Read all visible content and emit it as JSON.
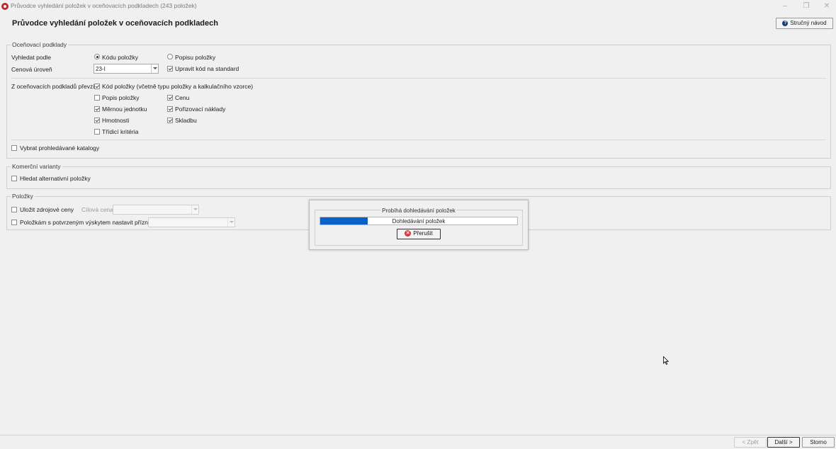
{
  "window": {
    "title": "Průvodce vyhledání položek v oceňovacích podkladech (243 položek)",
    "minimize_glyph": "–",
    "restore_glyph": "❐",
    "close_glyph": "✕"
  },
  "header": {
    "title": "Průvodce vyhledání položek v oceňovacích podkladech",
    "help_button": "Stručný návod",
    "help_icon_glyph": "?"
  },
  "pricing": {
    "legend": "Oceňovací podklady",
    "search_by_label": "Vyhledat podle",
    "search_options": [
      {
        "label": "Kódu položky",
        "selected": true
      },
      {
        "label": "Popisu položky",
        "selected": false
      }
    ],
    "price_level_label": "Cenová úroveň",
    "price_level_value": "23-I",
    "adjust_code_label": "Upravit kód na standard",
    "adjust_code_checked": true,
    "transfer_label": "Z oceňovacích podkladů převzít",
    "transfer_items": [
      {
        "label": "Kód položky (včetně typu položky a kalkulačního vzorce)",
        "checked": true
      },
      {
        "label": "Popis položky",
        "checked": false
      },
      {
        "label": "Cenu",
        "checked": true
      },
      {
        "label": "Měrnou jednotku",
        "checked": true
      },
      {
        "label": "Pořizovací náklady",
        "checked": true
      },
      {
        "label": "Hmotnosti",
        "checked": true
      },
      {
        "label": "Skladbu",
        "checked": true
      },
      {
        "label": "Třídicí kritéria",
        "checked": false
      }
    ],
    "select_catalogs_label": "Vybrat prohledávané katalogy",
    "select_catalogs_checked": false
  },
  "commercial": {
    "legend": "Komerční varianty",
    "alternative_label": "Hledat alternativní položky",
    "alternative_checked": false
  },
  "items": {
    "legend": "Položky",
    "save_prices_label": "Uložit zdrojové ceny",
    "save_prices_checked": false,
    "target_price_label": "Cílová cena",
    "flag_label": "Položkám s potvrzeným výskytem nastavit příznak",
    "flag_checked": false
  },
  "progress_dialog": {
    "title": "Probíhá dohledávání položek",
    "bar_text": "Dohledávání položek",
    "progress_fraction": 0.24,
    "stop_button": "Přerušit",
    "stop_icon_glyph": "✕",
    "bar_color": "#0a62c8"
  },
  "footer": {
    "back_button": "< Zpět",
    "next_button": "Další >",
    "cancel_button": "Storno"
  },
  "colors": {
    "app_icon": "#c0262d",
    "help_icon": "#1d3f77",
    "stop_icon": "#d6353a"
  }
}
